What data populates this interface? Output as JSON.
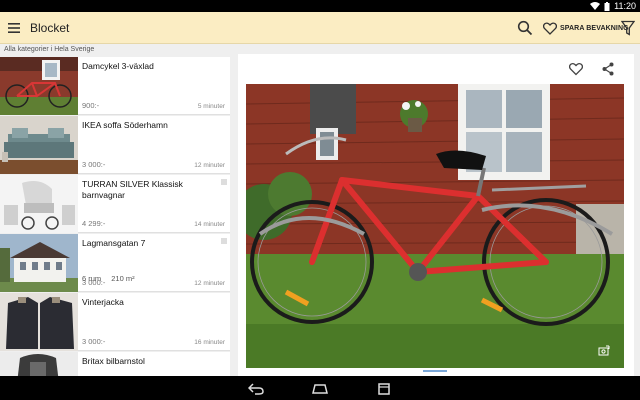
{
  "status_bar": {
    "time": "11:20"
  },
  "app_bar": {
    "title": "Blocket",
    "save_search_label": "SPARA BEVAKNING"
  },
  "breadcrumb": "Alla kategorier i Hela Sverige",
  "listings": [
    {
      "title": "Damcykel 3-växlad",
      "price": "900:-",
      "time": "5 minuter",
      "details": []
    },
    {
      "title": "IKEA soffa Söderhamn",
      "price": "3 000:-",
      "time": "12 minuter",
      "details": []
    },
    {
      "title": "TURRAN SILVER Klassisk barnvagnar",
      "price": "4 299:-",
      "time": "14 minuter",
      "details": []
    },
    {
      "title": "Lagmansgatan 7",
      "price": "3 000:-",
      "time": "12 minuter",
      "details": [
        "6 rum",
        "210 m²"
      ]
    },
    {
      "title": "Vinterjacka",
      "price": "3 000:-",
      "time": "16 minuter",
      "details": []
    },
    {
      "title": "Britax bilbarnstol",
      "price": "",
      "time": "",
      "details": []
    }
  ],
  "colors": {
    "app_bar": "#fbedc3",
    "accent_indicator": "#7aa7d8"
  },
  "icons": {
    "menu": "hamburger-icon",
    "search": "search-icon",
    "save": "heart-icon",
    "filter": "filter-icon",
    "favorite": "heart-outline-icon",
    "share": "share-icon",
    "zoom": "expand-icon"
  }
}
